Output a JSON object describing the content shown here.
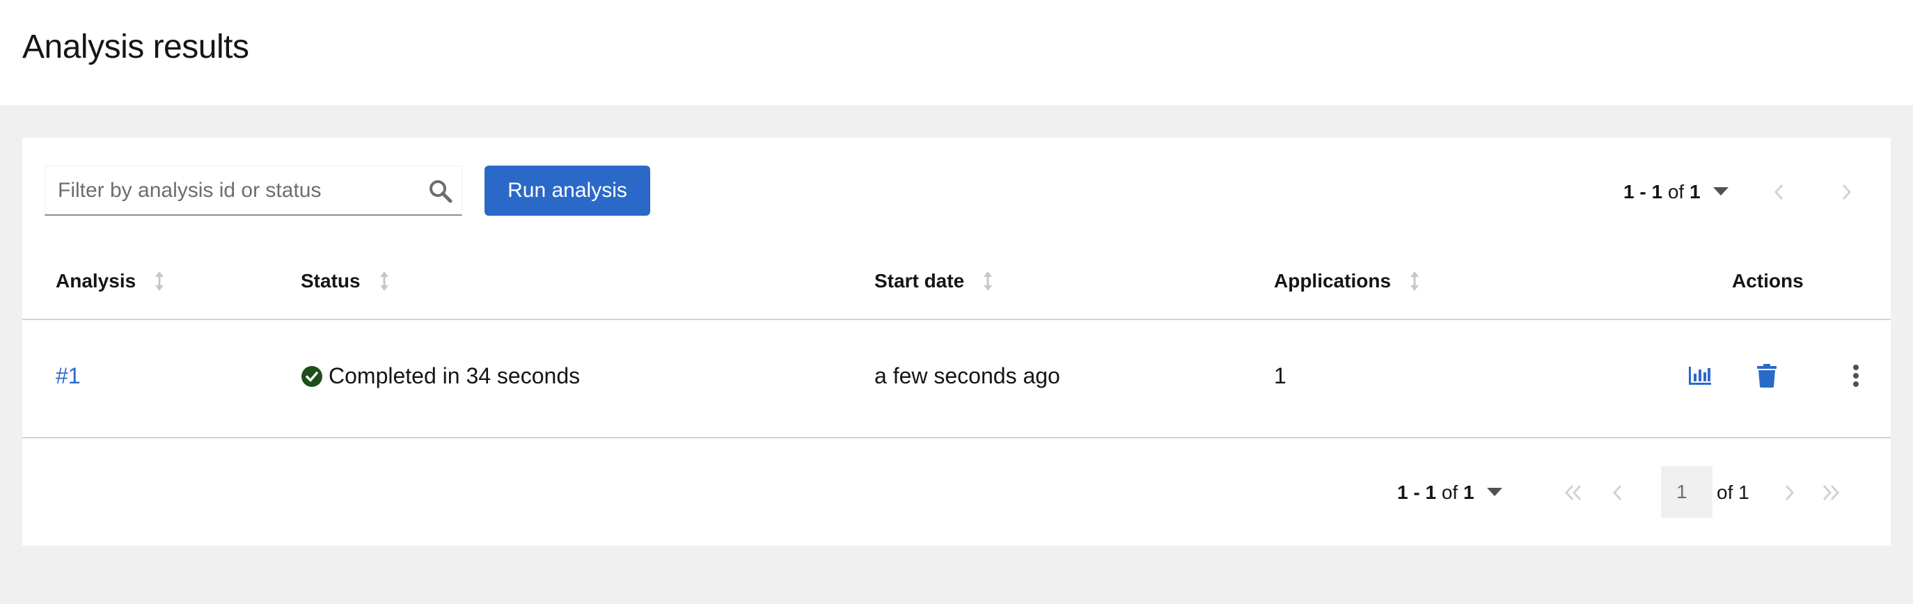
{
  "page": {
    "title": "Analysis results"
  },
  "toolbar": {
    "search_placeholder": "Filter by analysis id or status",
    "run_button_label": "Run analysis",
    "pagination_range": "1 - 1",
    "pagination_of": "of",
    "pagination_total": "1"
  },
  "table": {
    "columns": [
      "Analysis",
      "Status",
      "Start date",
      "Applications",
      "Actions"
    ],
    "rows": [
      {
        "analysis": "#1",
        "status": "Completed in 34 seconds",
        "start_date": "a few seconds ago",
        "applications": "1"
      }
    ]
  },
  "footer_pagination": {
    "range": "1 - 1",
    "of": "of",
    "total": "1",
    "current_page": "1",
    "of_pages": "of 1"
  },
  "icons": {
    "search": "search-icon",
    "caret": "caret-down-icon",
    "sort": "sort-icon",
    "status": "check-circle-icon",
    "report": "bar-chart-icon",
    "delete": "trash-icon",
    "kebab": "kebab-icon"
  },
  "colors": {
    "accent": "#2b69c9",
    "success": "#1e4f18",
    "page_bg": "#f0f0f0"
  }
}
